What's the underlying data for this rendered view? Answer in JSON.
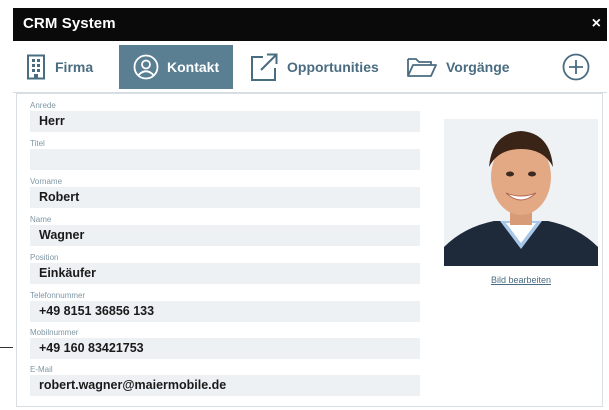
{
  "app": {
    "title": "CRM System",
    "close": "×"
  },
  "tabs": [
    {
      "label": "Firma",
      "icon": "building-icon"
    },
    {
      "label": "Kontakt",
      "icon": "person-icon",
      "active": true
    },
    {
      "label": "Opportunities",
      "icon": "external-link-icon"
    },
    {
      "label": "Vorgänge",
      "icon": "folder-icon"
    },
    {
      "label": "",
      "icon": "add-circle-icon"
    }
  ],
  "form": {
    "fields": [
      {
        "label": "Anrede",
        "value": "Herr"
      },
      {
        "label": "Titel",
        "value": ""
      },
      {
        "label": "Vorname",
        "value": "Robert"
      },
      {
        "label": "Name",
        "value": "Wagner"
      },
      {
        "label": "Position",
        "value": "Einkäufer"
      },
      {
        "label": "Telefonnummer",
        "value": "+49 8151 36856 133"
      },
      {
        "label": "Mobilnummer",
        "value": "+49 160 83421753"
      },
      {
        "label": "E-Mail",
        "value": "robert.wagner@maiermobile.de"
      }
    ]
  },
  "photo": {
    "edit_label": "Bild bearbeiten"
  },
  "colors": {
    "accent": "#5a7f93",
    "tab_text": "#4a6c80",
    "field_bg": "#edf1f3",
    "titlebar": "#0a0a0a"
  }
}
